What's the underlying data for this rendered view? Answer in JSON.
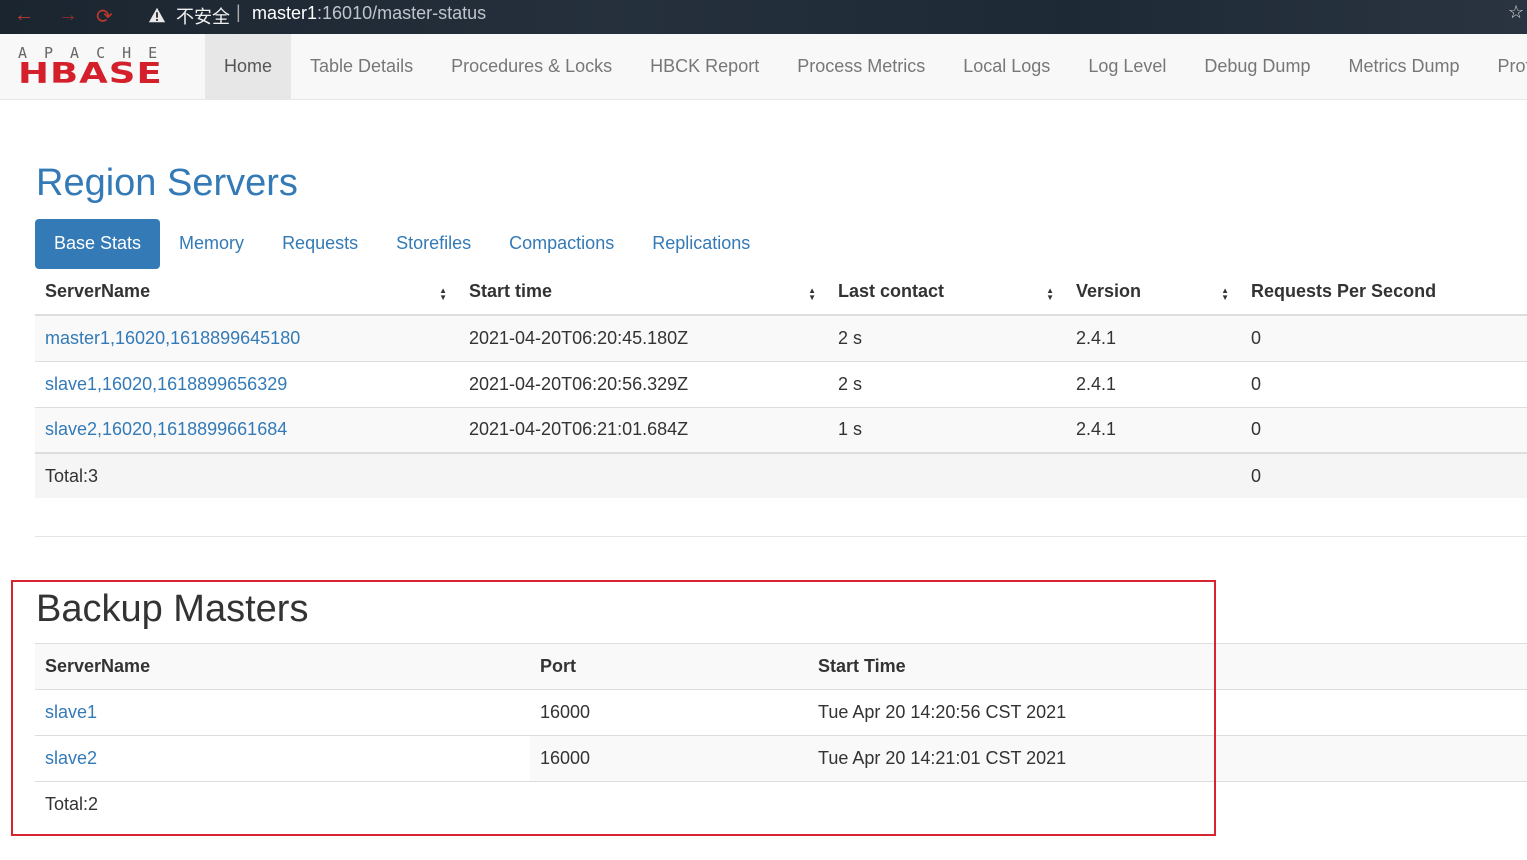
{
  "browser": {
    "insecure_label": "不安全",
    "separator": "|",
    "url_host": "master1",
    "url_rest": ":16010/master-status"
  },
  "navbar": {
    "logo_top": "APACHE",
    "logo_main": "HBASE",
    "links": [
      "Home",
      "Table Details",
      "Procedures & Locks",
      "HBCK Report",
      "Process Metrics",
      "Local Logs",
      "Log Level",
      "Debug Dump",
      "Metrics Dump",
      "Profiler"
    ],
    "active": "Home"
  },
  "region_servers": {
    "title": "Region Servers",
    "tabs": [
      "Base Stats",
      "Memory",
      "Requests",
      "Storefiles",
      "Compactions",
      "Replications"
    ],
    "active_tab": "Base Stats",
    "columns": [
      "ServerName",
      "Start time",
      "Last contact",
      "Version",
      "Requests Per Second"
    ],
    "rows": [
      [
        "master1,16020,1618899645180",
        "2021-04-20T06:20:45.180Z",
        "2 s",
        "2.4.1",
        "0"
      ],
      [
        "slave1,16020,1618899656329",
        "2021-04-20T06:20:56.329Z",
        "2 s",
        "2.4.1",
        "0"
      ],
      [
        "slave2,16020,1618899661684",
        "2021-04-20T06:21:01.684Z",
        "1 s",
        "2.4.1",
        "0"
      ]
    ],
    "total_label": "Total:3",
    "total_requests": "0"
  },
  "backup_masters": {
    "title": "Backup Masters",
    "columns": [
      "ServerName",
      "Port",
      "Start Time"
    ],
    "rows": [
      [
        "slave1",
        "16000",
        "Tue Apr 20 14:20:56 CST 2021"
      ],
      [
        "slave2",
        "16000",
        "Tue Apr 20 14:21:01 CST 2021"
      ]
    ],
    "total_label": "Total:2"
  },
  "colors": {
    "link": "#337ab7",
    "highlight_border": "#d8242e",
    "logo_red": "#d4202b"
  }
}
